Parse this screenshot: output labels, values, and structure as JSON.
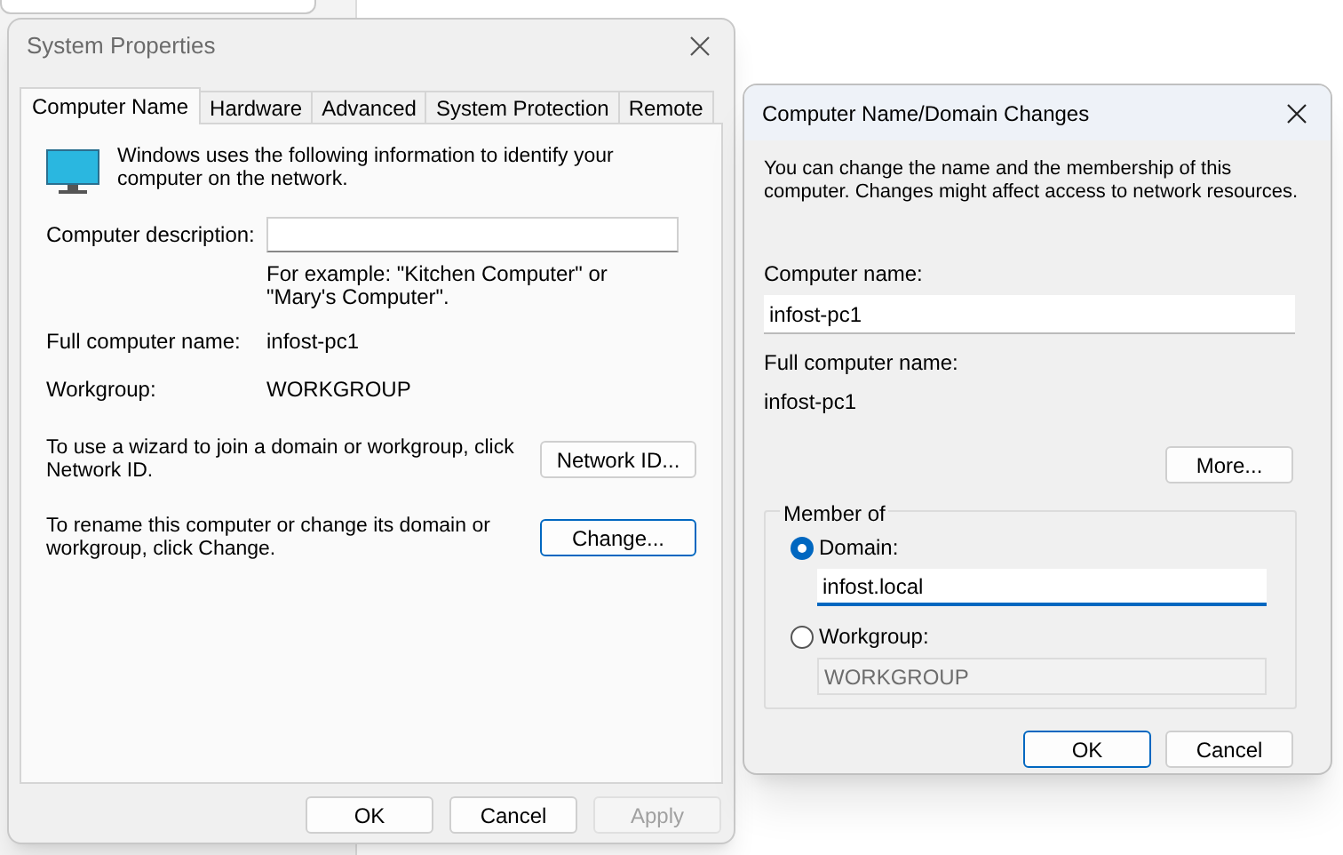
{
  "system_properties": {
    "title": "System Properties",
    "tabs": [
      {
        "label": "Computer Name",
        "selected": true
      },
      {
        "label": "Hardware",
        "selected": false
      },
      {
        "label": "Advanced",
        "selected": false
      },
      {
        "label": "System Protection",
        "selected": false
      },
      {
        "label": "Remote",
        "selected": false
      }
    ],
    "intro": "Windows uses the following information to identify your computer on the network.",
    "description": {
      "label": "Computer description:"
    },
    "hint": "For example: \"Kitchen Computer\" or \"Mary's Computer\".",
    "info": [
      {
        "label": "Full computer name:",
        "value": "infost-pc1"
      },
      {
        "label": "Workgroup:",
        "value": "WORKGROUP"
      }
    ],
    "sections": [
      {
        "text": "To use a wizard to join a domain or workgroup, click Network ID.",
        "button": "Network ID...",
        "focused": false
      },
      {
        "text": "To rename this computer or change its domain or workgroup, click Change.",
        "button": "Change...",
        "focused": true
      }
    ],
    "buttons": [
      {
        "label": "OK",
        "disabled": false
      },
      {
        "label": "Cancel",
        "disabled": false
      },
      {
        "label": "Apply",
        "disabled": true
      }
    ]
  },
  "domain_changes": {
    "title": "Computer Name/Domain Changes",
    "intro": "You can change the name and the membership of this computer. Changes might affect access to network resources.",
    "computer_name": {
      "label": "Computer name:",
      "value": "infost-pc1"
    },
    "full_name": {
      "label": "Full computer name:",
      "value": "infost-pc1"
    },
    "more_button": "More...",
    "member_of": {
      "legend": "Member of",
      "options": [
        {
          "label": "Domain:",
          "selected": true,
          "value": "infost.local"
        },
        {
          "label": "Workgroup:",
          "selected": false,
          "value": "WORKGROUP"
        }
      ]
    },
    "buttons": [
      {
        "label": "OK",
        "focused": true
      },
      {
        "label": "Cancel",
        "focused": false
      }
    ]
  }
}
